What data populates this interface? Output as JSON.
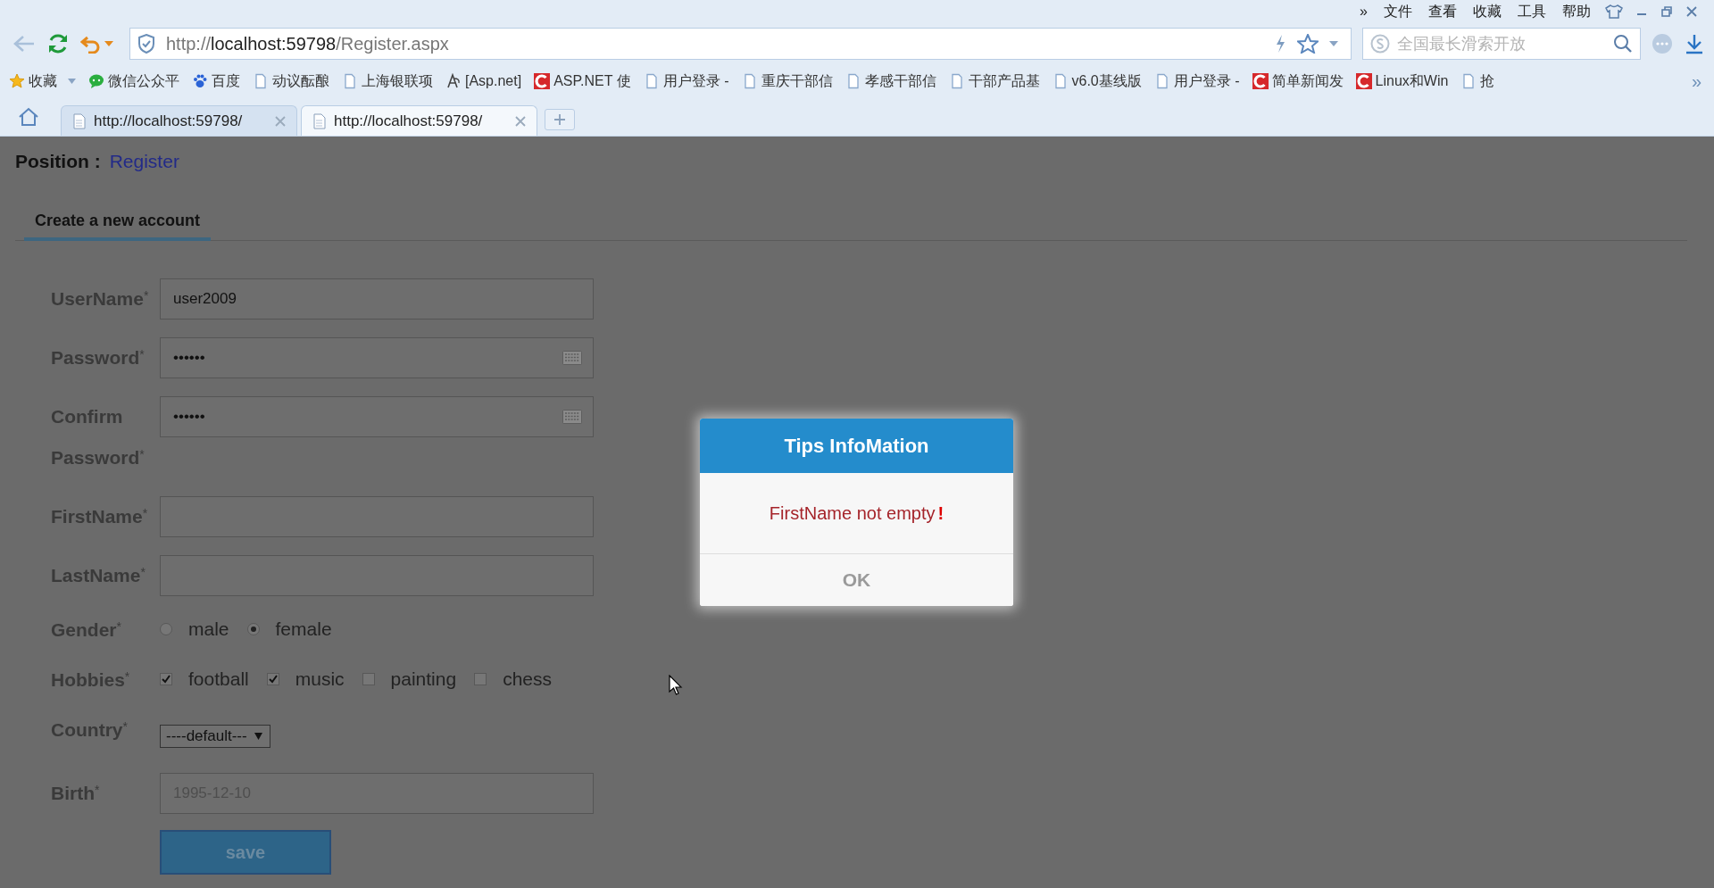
{
  "browser": {
    "menu": [
      "»",
      "文件",
      "查看",
      "收藏",
      "工具",
      "帮助"
    ],
    "address": {
      "scheme": "http://",
      "host": "localhost:59798",
      "path": "/Register.aspx"
    },
    "search": {
      "placeholder": "全国最长滑索开放"
    },
    "bookmarks": [
      {
        "label": "收藏",
        "kind": "favorites"
      },
      {
        "label": "微信公众平",
        "kind": "chat"
      },
      {
        "label": "百度",
        "kind": "paw"
      },
      {
        "label": "动议酝酿",
        "kind": "page"
      },
      {
        "label": "上海银联项",
        "kind": "page"
      },
      {
        "label": "[Asp.net]",
        "kind": "swirl"
      },
      {
        "label": "ASP.NET 使",
        "kind": "c-logo"
      },
      {
        "label": "用户登录 -",
        "kind": "page"
      },
      {
        "label": "重庆干部信",
        "kind": "page"
      },
      {
        "label": "孝感干部信",
        "kind": "page"
      },
      {
        "label": "干部产品基",
        "kind": "page"
      },
      {
        "label": "v6.0基线版",
        "kind": "page"
      },
      {
        "label": "用户登录 -",
        "kind": "page"
      },
      {
        "label": "简单新闻发",
        "kind": "c-logo"
      },
      {
        "label": "Linux和Win",
        "kind": "c-logo"
      },
      {
        "label": "抢",
        "kind": "page"
      }
    ],
    "bookmarks_overflow": "»",
    "tabs": [
      {
        "label": "http://localhost:59798/",
        "selected": false
      },
      {
        "label": "http://localhost:59798/",
        "selected": true
      }
    ]
  },
  "page": {
    "breadcrumb": {
      "label": "Position :",
      "link": "Register"
    },
    "section_tab": {
      "label": "Create a new account",
      "selected": true
    },
    "fields": [
      {
        "kind": "text",
        "label": "UserName$^{*}$",
        "value": "user2009"
      },
      {
        "kind": "password",
        "label": "Password$^{*}$",
        "value": "••••••"
      },
      {
        "kind": "password",
        "label": "Confirm Password$^{*}$",
        "value": "••••••"
      },
      {
        "kind": "text",
        "label": "FirstName$^{*}$"
      },
      {
        "kind": "text",
        "label": "LastName$^{*}$"
      },
      {
        "kind": "radio",
        "label": "Gender$^{*}$",
        "options": [
          {
            "label": "male",
            "selected": false
          },
          {
            "label": "female",
            "selected": true
          }
        ]
      },
      {
        "kind": "checkbox",
        "label": "Hobbies$^{*}$",
        "options": [
          {
            "label": "football",
            "checked": true
          },
          {
            "label": "music",
            "checked": true
          },
          {
            "label": "painting",
            "checked": false
          },
          {
            "label": "chess",
            "checked": false
          }
        ]
      },
      {
        "kind": "select",
        "label": "Country$^{*}$",
        "value": "----default---"
      },
      {
        "kind": "date",
        "label": "Birth$^{*}$",
        "placeholder": "1995-12-10"
      }
    ],
    "save_button": "save"
  },
  "dialog": {
    "title": "Tips InfoMation",
    "message": "FirstName not empty",
    "mark": "!",
    "button": "OK"
  }
}
